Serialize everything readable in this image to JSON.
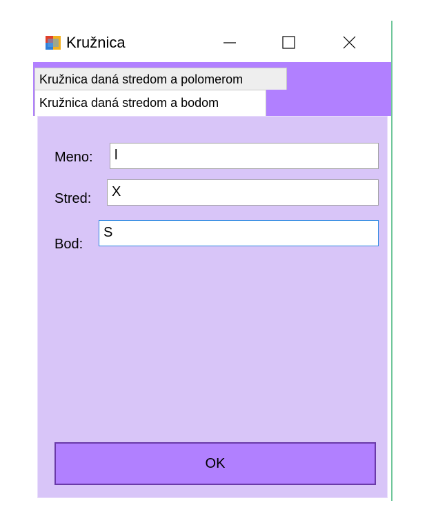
{
  "window": {
    "title": "Kružnica",
    "accent_color": "#b180ff",
    "panel_color": "#d8c5f8",
    "icons": {
      "app": "app-icon",
      "minimize": "minimize-icon",
      "maximize": "maximize-icon",
      "close": "close-icon"
    }
  },
  "tabs": [
    {
      "label": "Kružnica daná stredom a polomerom",
      "selected": false
    },
    {
      "label": "Kružnica daná stredom a bodom",
      "selected": true
    }
  ],
  "form": {
    "meno": {
      "label": "Meno:",
      "value": "l"
    },
    "stred": {
      "label": "Stred:",
      "value": "X"
    },
    "bod": {
      "label": "Bod:",
      "value": "S"
    }
  },
  "ok_label": "OK"
}
